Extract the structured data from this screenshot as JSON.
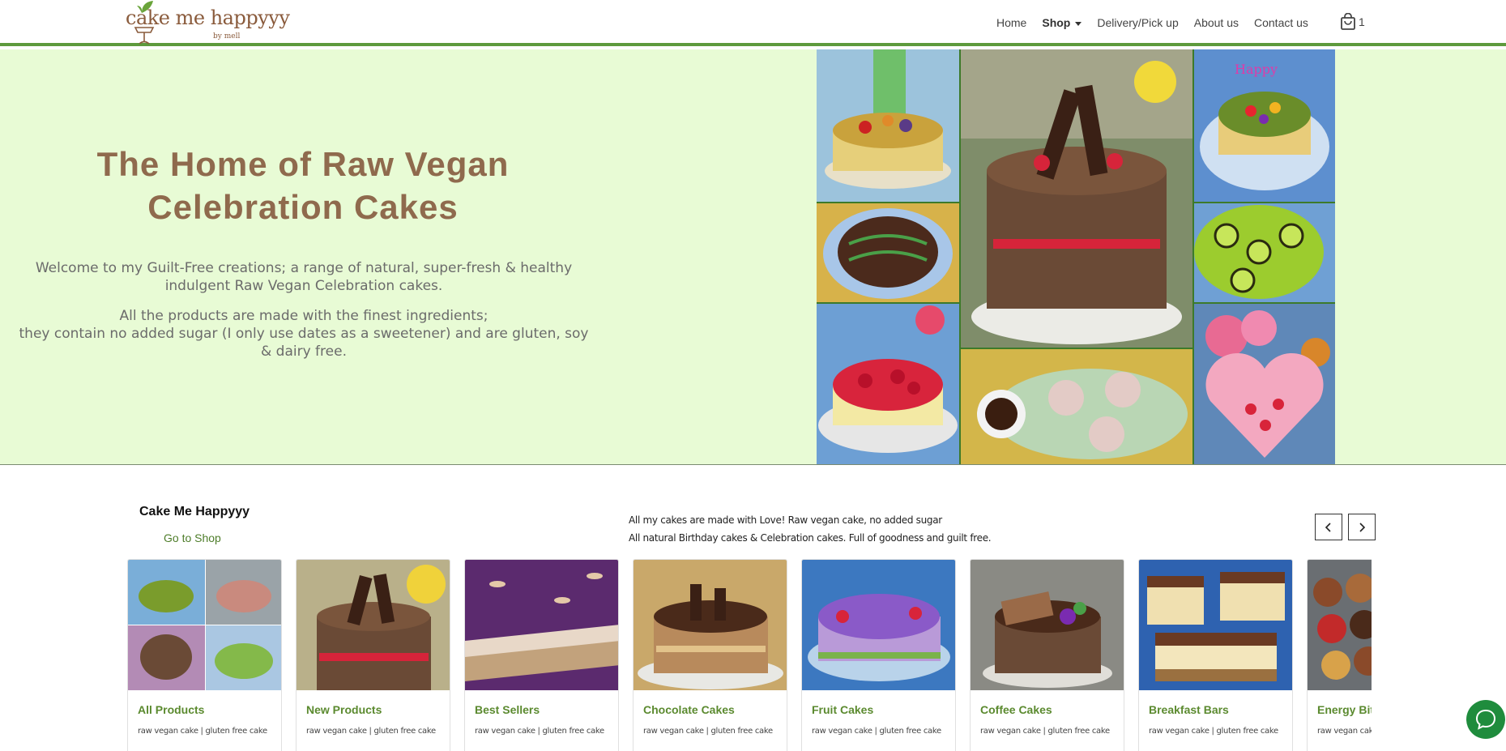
{
  "brand": {
    "logo_text": "cake me happyyy",
    "logo_sub": "by mell"
  },
  "nav": {
    "items": [
      "Home",
      "Shop",
      "Delivery/Pick up",
      "About us",
      "Contact us"
    ],
    "cart_count": "1"
  },
  "hero": {
    "title_line1": "The Home of Raw Vegan",
    "title_line2": "Celebration Cakes",
    "paragraph1": "Welcome to my Guilt-Free creations; a range of natural, super-fresh & healthy indulgent Raw Vegan Celebration cakes.",
    "paragraph2_line1": "All the products are made with the finest ingredients;",
    "paragraph2_line2": "they contain no added sugar (I only use dates as a sweetener) and are gluten, soy & dairy free."
  },
  "categories": {
    "title": "Cake Me Happyyy",
    "link": "Go to Shop",
    "description_line1": "All my cakes are made with Love! Raw vegan cake, no added sugar",
    "description_line2": "All natural Birthday cakes & Celebration cakes. Full of goodness and guilt free.",
    "items": [
      {
        "title": "All Products",
        "subtitle": "raw vegan cake | gluten free cake"
      },
      {
        "title": "New Products",
        "subtitle": "raw vegan cake | gluten free cake"
      },
      {
        "title": "Best Sellers",
        "subtitle": "raw vegan cake | gluten free cake"
      },
      {
        "title": "Chocolate Cakes",
        "subtitle": "raw vegan cake | gluten free cake"
      },
      {
        "title": "Fruit Cakes",
        "subtitle": "raw vegan cake | gluten free cake"
      },
      {
        "title": "Coffee Cakes",
        "subtitle": "raw vegan cake | gluten free cake"
      },
      {
        "title": "Breakfast Bars",
        "subtitle": "raw vegan cake | gluten free cake"
      },
      {
        "title": "Energy Bites",
        "subtitle": "raw vegan cake | gluten free cake"
      }
    ]
  },
  "colors": {
    "accent_green": "#5d9a3c",
    "hero_bg": "#e8fbd5",
    "title_brown": "#8f6a4d",
    "card_title_green": "#5b8a2f",
    "chat_green": "#1f8c3d"
  },
  "icons": [
    "cart-icon",
    "chevron-left-icon",
    "chevron-right-icon",
    "chat-icon"
  ]
}
